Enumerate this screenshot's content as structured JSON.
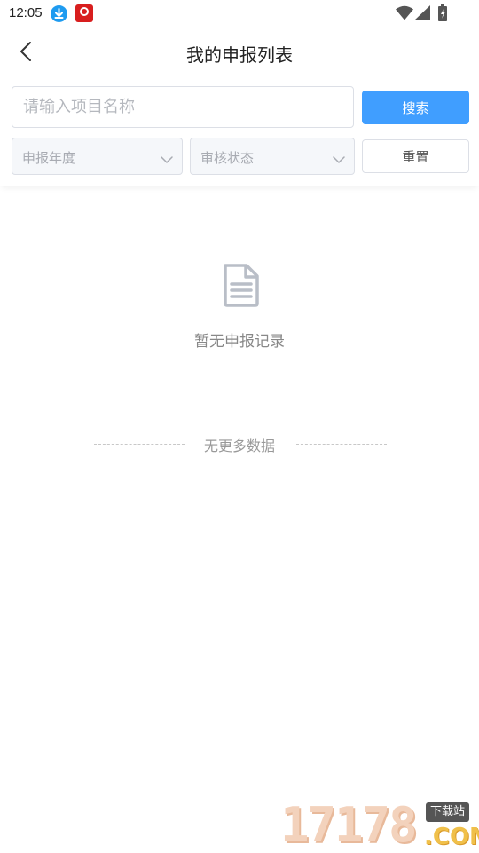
{
  "status_bar": {
    "time": "12:05",
    "icons": [
      "download-icon",
      "app-notification-icon",
      "wifi-icon",
      "signal-icon",
      "battery-charging-icon"
    ]
  },
  "header": {
    "title": "我的申报列表",
    "back_icon": "chevron-left-icon"
  },
  "search": {
    "placeholder": "请输入项目名称",
    "value": "",
    "button_label": "搜索"
  },
  "filters": {
    "year_placeholder": "申报年度",
    "status_placeholder": "审核状态",
    "reset_label": "重置"
  },
  "empty_state": {
    "icon": "document-icon",
    "message": "暂无申报记录"
  },
  "list_footer": {
    "no_more_text": "无更多数据"
  },
  "watermark": {
    "digits": "17178",
    "badge": "下载站",
    "com": ".COM"
  },
  "colors": {
    "primary": "#409eff",
    "border": "#dcdfe6",
    "select_bg": "#f5f7fa",
    "placeholder": "#b5b8be"
  }
}
